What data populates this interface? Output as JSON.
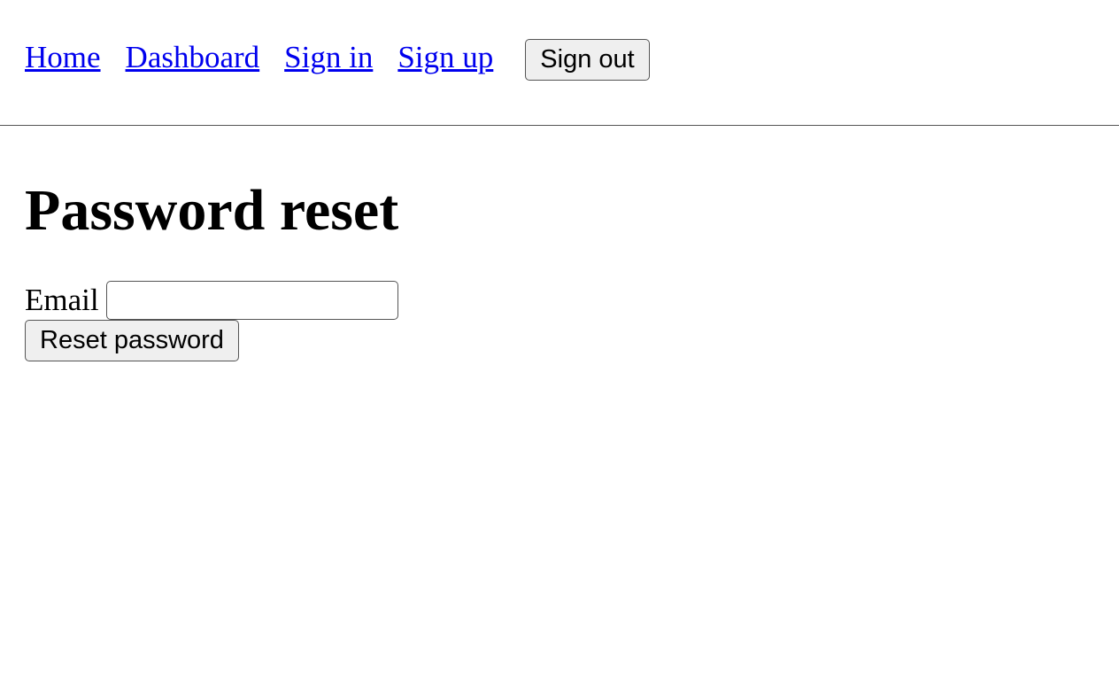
{
  "nav": {
    "home": "Home",
    "dashboard": "Dashboard",
    "signin": "Sign in",
    "signup": "Sign up",
    "signout": "Sign out"
  },
  "page": {
    "title": "Password reset"
  },
  "form": {
    "email_label": "Email",
    "email_value": "",
    "submit_label": "Reset password"
  }
}
